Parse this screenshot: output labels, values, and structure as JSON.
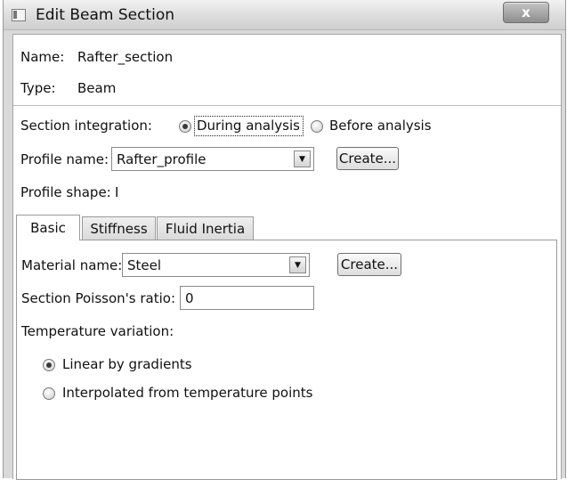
{
  "window": {
    "title": "Edit Beam Section",
    "close_glyph": "x"
  },
  "info": {
    "name_label": "Name:",
    "name_value": "Rafter_section",
    "type_label": "Type:",
    "type_value": "Beam"
  },
  "integration": {
    "label": "Section integration:",
    "options": [
      {
        "label": "During analysis",
        "checked": true
      },
      {
        "label": "Before analysis",
        "checked": false
      }
    ]
  },
  "profile": {
    "name_label": "Profile name:",
    "name_value": "Rafter_profile",
    "create_label": "Create...",
    "shape_label": "Profile shape:",
    "shape_value": "I"
  },
  "tabs": [
    {
      "label": "Basic",
      "active": true
    },
    {
      "label": "Stiffness",
      "active": false
    },
    {
      "label": "Fluid Inertia",
      "active": false
    }
  ],
  "basic": {
    "material_label": "Material name:",
    "material_value": "Steel",
    "create_label": "Create...",
    "poisson_label": "Section Poisson's ratio:",
    "poisson_value": "0",
    "temp_label": "Temperature variation:",
    "temp_options": [
      {
        "label": "Linear by gradients",
        "checked": true
      },
      {
        "label": "Interpolated from temperature points",
        "checked": false
      }
    ]
  },
  "icons": {
    "app": "window-app-icon",
    "close": "close-icon",
    "dropdown": "chevron-down-icon"
  },
  "colors": {
    "titlebar": "#dcdcdc",
    "frame": "#d9d9d9",
    "panel": "#ffffff"
  }
}
